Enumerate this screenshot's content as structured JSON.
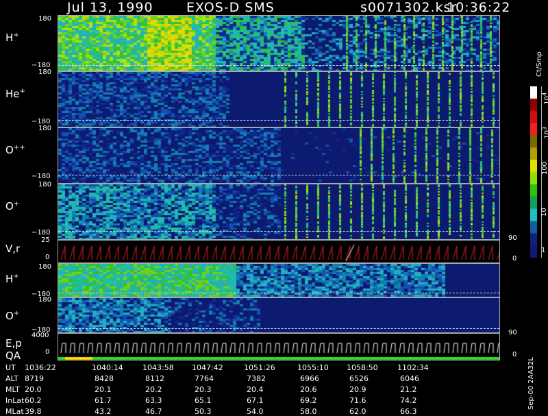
{
  "header": {
    "date": "Jul 13, 1990",
    "instrument": "EXOS-D SMS",
    "file": "s0071302.ksr",
    "time": "10:36:22"
  },
  "panels": [
    {
      "label": "H",
      "charge": "+",
      "top_tick": "180",
      "bottom_tick": "−180"
    },
    {
      "label": "He",
      "charge": "+",
      "top_tick": "180",
      "bottom_tick": "−180"
    },
    {
      "label": "O",
      "charge": "++",
      "top_tick": "180",
      "bottom_tick": "−180"
    },
    {
      "label": "O",
      "charge": "+",
      "top_tick": "180",
      "bottom_tick": "−180"
    },
    {
      "label": "V,r",
      "charge": "",
      "top_tick": "25",
      "bottom_tick": "0",
      "right_tick": "90",
      "right_tick2": "0"
    },
    {
      "label": "H",
      "charge": "+",
      "top_tick": "180",
      "bottom_tick": "−180"
    },
    {
      "label": "O",
      "charge": "+",
      "top_tick": "180",
      "bottom_tick": "−180"
    },
    {
      "label": "E,p",
      "label2": "QA",
      "charge": "",
      "top_tick": "4000",
      "bottom_tick": "0",
      "right_tick": "90",
      "right_tick2": "0"
    }
  ],
  "colorbar": {
    "unit": "Ct/Smp",
    "ticks": [
      "10",
      "4",
      "10",
      "3",
      "100",
      "10",
      "1"
    ],
    "colors": [
      "#ffffff",
      "#8b0000",
      "#cc1010",
      "#ee2020",
      "#7a6a00",
      "#b0a000",
      "#e0e000",
      "#90e000",
      "#30c010",
      "#10a060",
      "#20c0c0",
      "#1060a0",
      "#102080",
      "#101870"
    ]
  },
  "ephemeris": {
    "rows": [
      {
        "name": "UT",
        "values": [
          "1036:22",
          "1040:14",
          "1043:58",
          "1047:42",
          "1051:26",
          "1055:10",
          "1058:50",
          "1102:34"
        ]
      },
      {
        "name": "ALT",
        "values": [
          "8719",
          "8428",
          "8112",
          "7764",
          "7382",
          "6966",
          "6526",
          "6046"
        ]
      },
      {
        "name": "MLT",
        "values": [
          "20.0",
          "20.1",
          "20.2",
          "20.3",
          "20.4",
          "20.6",
          "20.9",
          "21.2"
        ]
      },
      {
        "name": "InLat",
        "values": [
          "60.2",
          "61.7",
          "63.3",
          "65.1",
          "67.1",
          "69.2",
          "71.6",
          "74.2"
        ]
      },
      {
        "name": "MLat",
        "values": [
          "39.8",
          "43.2",
          "46.7",
          "50.3",
          "54.0",
          "58.0",
          "62.0",
          "66.3"
        ]
      }
    ]
  },
  "side_label": "Sep-00  2AA32L",
  "colors": {
    "background": "#000000",
    "low": "#0c1a70",
    "axis": "#aaaaaa"
  }
}
